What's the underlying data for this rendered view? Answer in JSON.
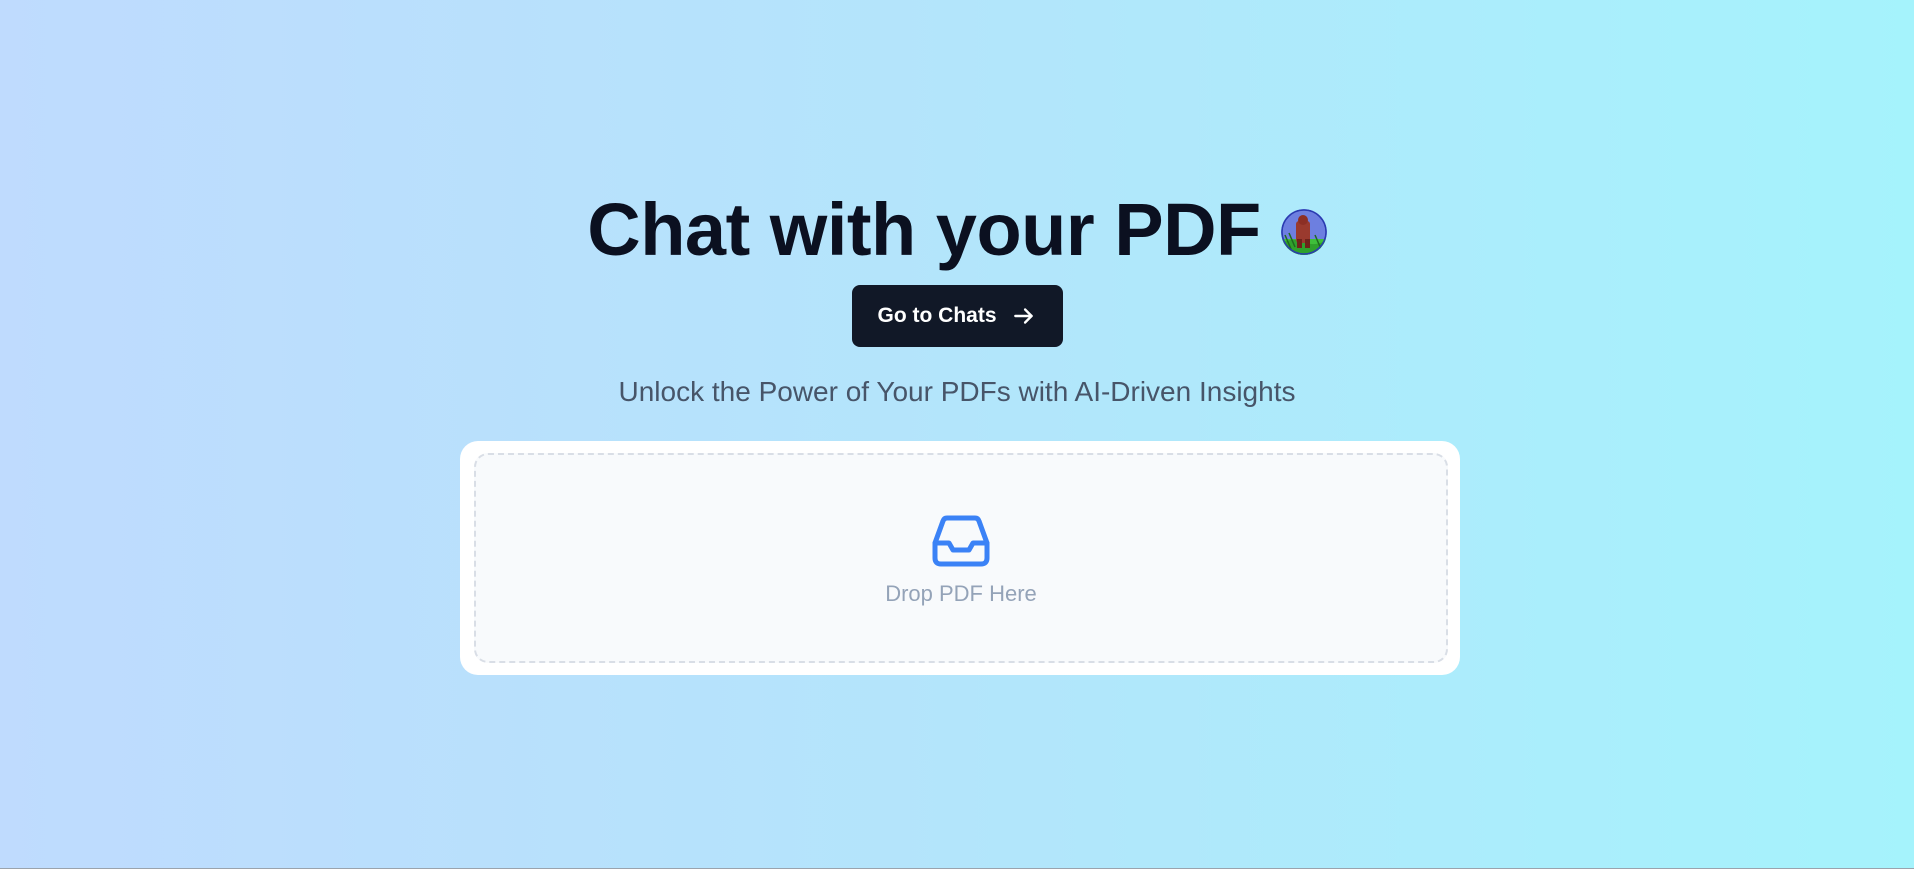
{
  "hero": {
    "title": "Chat with your PDF",
    "avatar_icon": "user-avatar"
  },
  "cta": {
    "label": "Go to Chats",
    "icon": "arrow-right-icon"
  },
  "subtitle": "Unlock the Power of Your PDFs with AI-Driven Insights",
  "upload": {
    "label": "Drop PDF Here",
    "icon": "inbox-icon",
    "icon_color": "#3b82f6"
  },
  "colors": {
    "background_start": "#bfdbfe",
    "background_end": "#a5f3fc",
    "button": "#111827",
    "title": "#0b1020"
  }
}
